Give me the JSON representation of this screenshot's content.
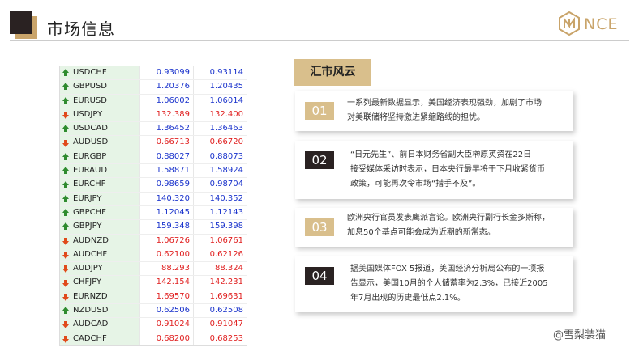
{
  "header": {
    "title": "市场信息"
  },
  "logo": {
    "text": "NCE"
  },
  "quotes": [
    {
      "symbol": "USDCHF",
      "bid": "0.93099",
      "ask": "0.93114",
      "dir": "up"
    },
    {
      "symbol": "GBPUSD",
      "bid": "1.20376",
      "ask": "1.20435",
      "dir": "up"
    },
    {
      "symbol": "EURUSD",
      "bid": "1.06002",
      "ask": "1.06014",
      "dir": "up"
    },
    {
      "symbol": "USDJPY",
      "bid": "132.389",
      "ask": "132.400",
      "dir": "down"
    },
    {
      "symbol": "USDCAD",
      "bid": "1.36452",
      "ask": "1.36463",
      "dir": "up"
    },
    {
      "symbol": "AUDUSD",
      "bid": "0.66713",
      "ask": "0.66720",
      "dir": "down"
    },
    {
      "symbol": "EURGBP",
      "bid": "0.88027",
      "ask": "0.88073",
      "dir": "up"
    },
    {
      "symbol": "EURAUD",
      "bid": "1.58871",
      "ask": "1.58924",
      "dir": "up"
    },
    {
      "symbol": "EURCHF",
      "bid": "0.98659",
      "ask": "0.98704",
      "dir": "up"
    },
    {
      "symbol": "EURJPY",
      "bid": "140.320",
      "ask": "140.352",
      "dir": "up"
    },
    {
      "symbol": "GBPCHF",
      "bid": "1.12045",
      "ask": "1.12143",
      "dir": "up"
    },
    {
      "symbol": "GBPJPY",
      "bid": "159.348",
      "ask": "159.398",
      "dir": "up"
    },
    {
      "symbol": "AUDNZD",
      "bid": "1.06726",
      "ask": "1.06761",
      "dir": "down"
    },
    {
      "symbol": "AUDCHF",
      "bid": "0.62100",
      "ask": "0.62126",
      "dir": "down"
    },
    {
      "symbol": "AUDJPY",
      "bid": "88.293",
      "ask": "88.324",
      "dir": "down"
    },
    {
      "symbol": "CHFJPY",
      "bid": "142.154",
      "ask": "142.231",
      "dir": "down"
    },
    {
      "symbol": "EURNZD",
      "bid": "1.69570",
      "ask": "1.69631",
      "dir": "down"
    },
    {
      "symbol": "NZDUSD",
      "bid": "0.62506",
      "ask": "0.62508",
      "dir": "up"
    },
    {
      "symbol": "AUDCAD",
      "bid": "0.91024",
      "ask": "0.91047",
      "dir": "down"
    },
    {
      "symbol": "CADCHF",
      "bid": "0.68200",
      "ask": "0.68253",
      "dir": "down"
    }
  ],
  "news": {
    "header": "汇市风云",
    "items": [
      {
        "num": "01",
        "lines": [
          "一系列最新数据显示，美国经济表现强劲，加剧了市场",
          "对美联储将坚持激进紧缩路线的担忧。"
        ]
      },
      {
        "num": "02",
        "lines": [
          "“日元先生”、前日本财务省副大臣榊原英资在22日",
          "接受媒体采访时表示，日本央行最早将于下月收紧货币",
          "政策，可能再次令市场“措手不及”。"
        ]
      },
      {
        "num": "03",
        "lines": [
          "欧洲央行官员发表鹰派言论。欧洲央行副行长金多斯称，",
          "加息50个基点可能会成为近期的新常态。"
        ]
      },
      {
        "num": "04",
        "lines": [
          "据美国媒体FOX 5报道，美国经济分析局公布的一项报",
          "告显示，美国10月的个人储蓄率为2.3%，已接近2005",
          "年7月出现的历史最低点2.1%。"
        ]
      }
    ]
  },
  "watermark": {
    "text": "@雪梨装猫"
  },
  "colors": {
    "gold": "#d9bf8c",
    "dark": "#2a2222",
    "up_green": "#2e8b2e",
    "down_red": "#e02020",
    "bid_blue": "#1a33cc"
  }
}
